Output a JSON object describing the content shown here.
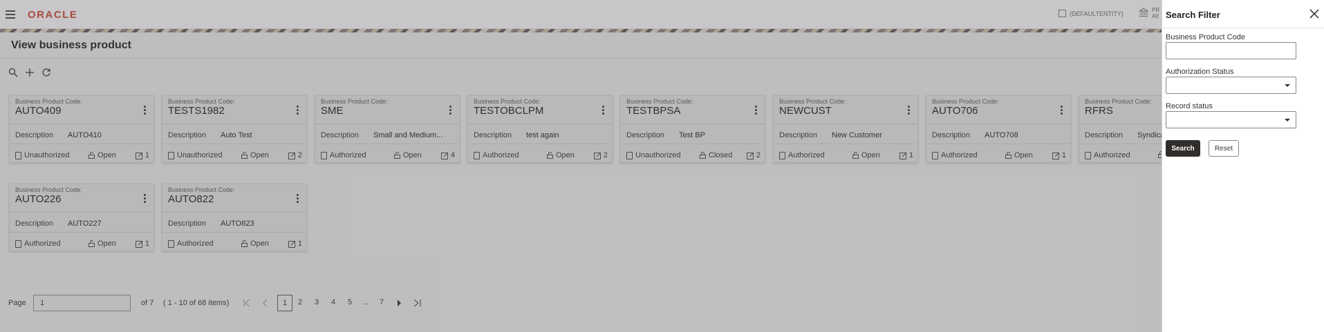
{
  "header": {
    "logo": "ORACLE",
    "entity": "(DEFAULTENTITY)",
    "bank_line1": "PR",
    "bank_line2": "A0"
  },
  "page": {
    "title": "View business product"
  },
  "cards": [
    {
      "code_label": "Business Product Code:",
      "code": "AUTO409",
      "desc_label": "Description",
      "desc": "AUTO410",
      "auth": "Unauthorized",
      "record": "Open",
      "version": "1"
    },
    {
      "code_label": "Business Product Code:",
      "code": "TESTS1982",
      "desc_label": "Description",
      "desc": "Auto Test",
      "auth": "Unauthorized",
      "record": "Open",
      "version": "2"
    },
    {
      "code_label": "Business Product Code:",
      "code": "SME",
      "desc_label": "Description",
      "desc": "Small and Medium...",
      "auth": "Authorized",
      "record": "Open",
      "version": "4"
    },
    {
      "code_label": "Business Product Code:",
      "code": "TESTOBCLPM",
      "desc_label": "Description",
      "desc": "test again",
      "auth": "Authorized",
      "record": "Open",
      "version": "2"
    },
    {
      "code_label": "Business Product Code:",
      "code": "TESTBPSA",
      "desc_label": "Description",
      "desc": "Test BP",
      "auth": "Unauthorized",
      "record": "Closed",
      "version": "2"
    },
    {
      "code_label": "Business Product Code:",
      "code": "NEWCUST",
      "desc_label": "Description",
      "desc": "New Customer",
      "auth": "Authorized",
      "record": "Open",
      "version": "1"
    },
    {
      "code_label": "Business Product Code:",
      "code": "AUTO706",
      "desc_label": "Description",
      "desc": "AUTO708",
      "auth": "Authorized",
      "record": "Open",
      "version": "1"
    },
    {
      "code_label": "Business Product Code:",
      "code": "RFRS",
      "desc_label": "Description",
      "desc": "Syndica",
      "auth": "Authorized",
      "record": "",
      "version": ""
    },
    {
      "code_label": "Business Product Code:",
      "code": "AUTO226",
      "desc_label": "Description",
      "desc": "AUTO227",
      "auth": "Authorized",
      "record": "Open",
      "version": "1"
    },
    {
      "code_label": "Business Product Code:",
      "code": "AUTO822",
      "desc_label": "Description",
      "desc": "AUTO823",
      "auth": "Authorized",
      "record": "Open",
      "version": "1"
    }
  ],
  "pagination": {
    "page_label": "Page",
    "current_page": "1",
    "of_label": "of 7",
    "items_label": "( 1 - 10 of 68 items)",
    "pages": [
      "1",
      "2",
      "3",
      "4",
      "5",
      "...",
      "7"
    ]
  },
  "filter": {
    "title": "Search Filter",
    "fields": [
      {
        "label": "Business Product Code",
        "value": ""
      },
      {
        "label": "Authorization Status",
        "value": ""
      },
      {
        "label": "Record status",
        "value": ""
      }
    ],
    "search_label": "Search",
    "reset_label": "Reset"
  },
  "colors": {
    "brand": "#c74634",
    "primary_button": "#312d2a"
  }
}
